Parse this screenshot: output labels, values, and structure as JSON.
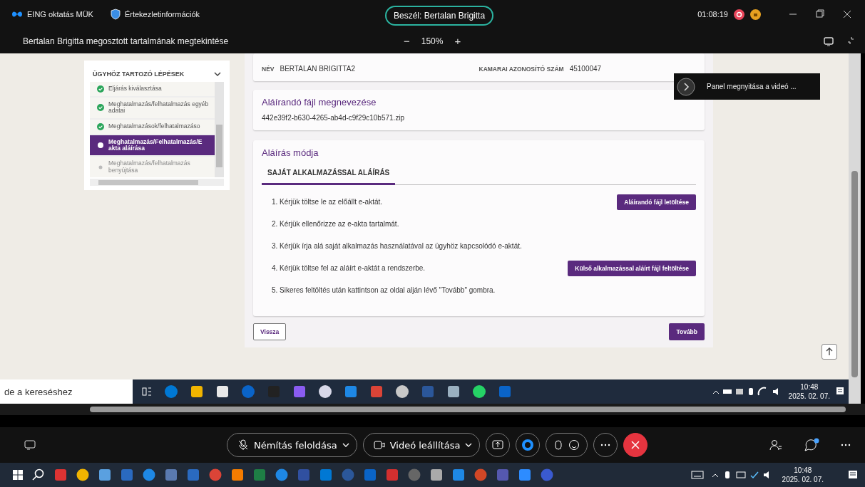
{
  "meeting_bar": {
    "app_name": "EING oktatás MÜK",
    "info_label": "Értekezletinformációk",
    "speaker": "Beszél: Bertalan Brigitta",
    "elapsed": "01:08:19"
  },
  "share_bar": {
    "title": "Bertalan Brigitta megosztott tartalmának megtekintése",
    "zoom_out": "−",
    "zoom": "150%",
    "zoom_in": "+"
  },
  "shared_page": {
    "steps_panel": {
      "title": "ÜGYHÖZ TARTOZÓ LÉPÉSEK",
      "steps": [
        {
          "label": "Eljárás kiválasztása",
          "completed": true,
          "selected": false
        },
        {
          "label": "Meghatalmazás/felhatalmazás egyéb adatai",
          "completed": true,
          "selected": false
        },
        {
          "label": "Meghatalmazások/felhatalmazáso",
          "completed": true,
          "selected": false
        },
        {
          "label": "Meghatalmazás/Felhatalmazás/E akta aláírása",
          "completed": false,
          "selected": true
        },
        {
          "label": "Meghatalmazás/felhatalmazás benyújtása",
          "completed": false,
          "selected": false
        }
      ]
    },
    "applicant": {
      "name_label": "NÉV",
      "name": "BERTALAN BRIGITTA2",
      "id_label": "KAMARAI AZONOSÍTÓ SZÁM",
      "id": "45100047"
    },
    "file_card": {
      "heading": "Aláírandó fájl megnevezése",
      "filename": "442e39f2-b630-4265-ab4d-c9f29c10b571.zip"
    },
    "signing_card": {
      "heading": "Aláírás módja",
      "tabs": [
        {
          "label": "SAJÁT ALKALMAZÁSSAL ALÁÍRÁS",
          "selected": true
        }
      ],
      "instructions": [
        {
          "text": "1. Kérjük töltse le az előállt e-aktát.",
          "button": "Aláírandó fájl letöltése"
        },
        {
          "text": "2. Kérjük ellenőrizze az e-akta tartalmát."
        },
        {
          "text": "3. Kérjük írja alá saját alkalmazás használatával az ügyhöz kapcsolódó e-aktát."
        },
        {
          "text": "4. Kérjük töltse fel az aláírt e-aktát a rendszerbe.",
          "button": "Külső alkalmazással aláírt fájl feltöltése"
        },
        {
          "text": "5. Sikeres feltöltés után kattintson az oldal alján lévő \"Tovább\" gombra."
        }
      ]
    },
    "back_button": "Vissza",
    "next_button": "Tovább",
    "tooltip": "Panel megnyitása a videó ..."
  },
  "remote_taskbar": {
    "placeholder": "de a kereséshez",
    "time": "10:48",
    "date": "2025. 02. 07."
  },
  "controls": {
    "mute": "Némítás feloldása",
    "video": "Videó leállítása"
  },
  "taskbar": {
    "time": "10:48",
    "date": "2025. 02. 07."
  }
}
